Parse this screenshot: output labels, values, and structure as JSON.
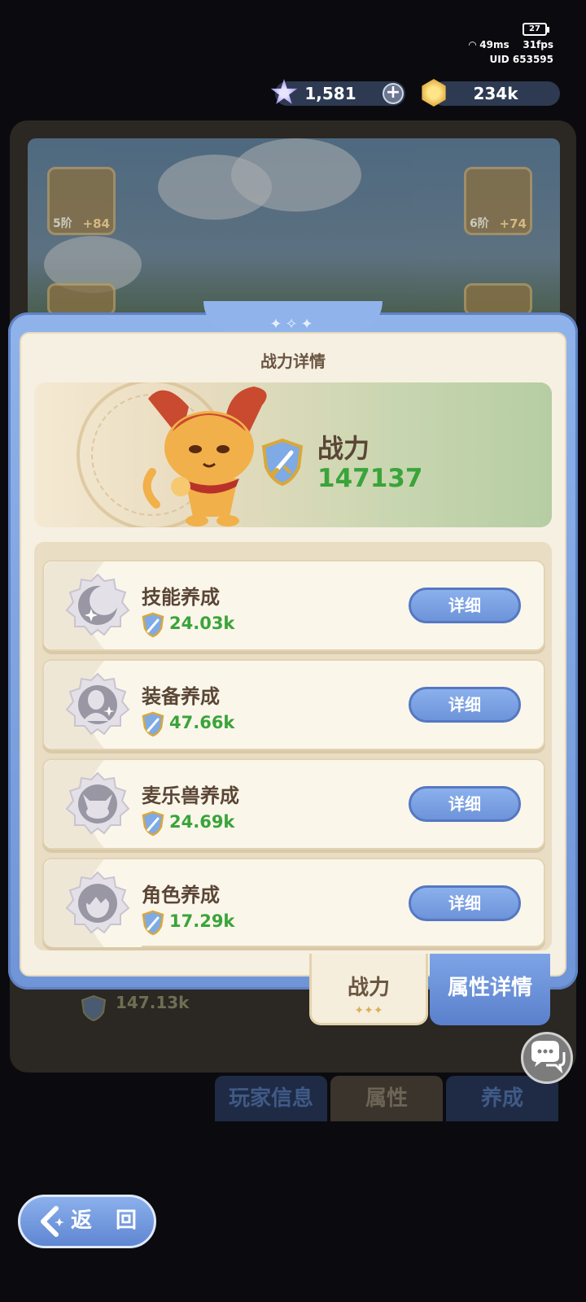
{
  "status": {
    "battery": "27",
    "ping": "49ms",
    "fps": "31fps",
    "uid": "UID 653595"
  },
  "resources": {
    "gems": "1,581",
    "gems_icon": "star-gem-icon",
    "add_icon": "plus-icon",
    "gold": "234k",
    "gold_icon": "gold-coin-icon"
  },
  "background": {
    "equip_left": {
      "tier": "5阶",
      "plus": "+84"
    },
    "equip_right": {
      "tier": "6阶",
      "plus": "+74"
    },
    "power_total": "147.13k",
    "tabs": [
      "玩家信息",
      "属性",
      "养成"
    ]
  },
  "modal": {
    "title": "战力详情",
    "power_label": "战力",
    "power_value": "147137",
    "rows": [
      {
        "name": "技能养成",
        "value": "24.03k",
        "button": "详细",
        "icon": "skill-moon-icon"
      },
      {
        "name": "装备养成",
        "value": "47.66k",
        "button": "详细",
        "icon": "equipment-figure-icon"
      },
      {
        "name": "麦乐兽养成",
        "value": "24.69k",
        "button": "详细",
        "icon": "pet-cat-icon"
      },
      {
        "name": "角色养成",
        "value": "17.29k",
        "button": "详细",
        "icon": "character-head-icon"
      }
    ],
    "tabs": {
      "active": "战力",
      "inactive": "属性详情"
    }
  },
  "back_button": {
    "label": "返 回"
  },
  "colors": {
    "accent_blue": "#6d93da",
    "power_green": "#3aa43a",
    "panel_cream": "#f6f0e2"
  }
}
